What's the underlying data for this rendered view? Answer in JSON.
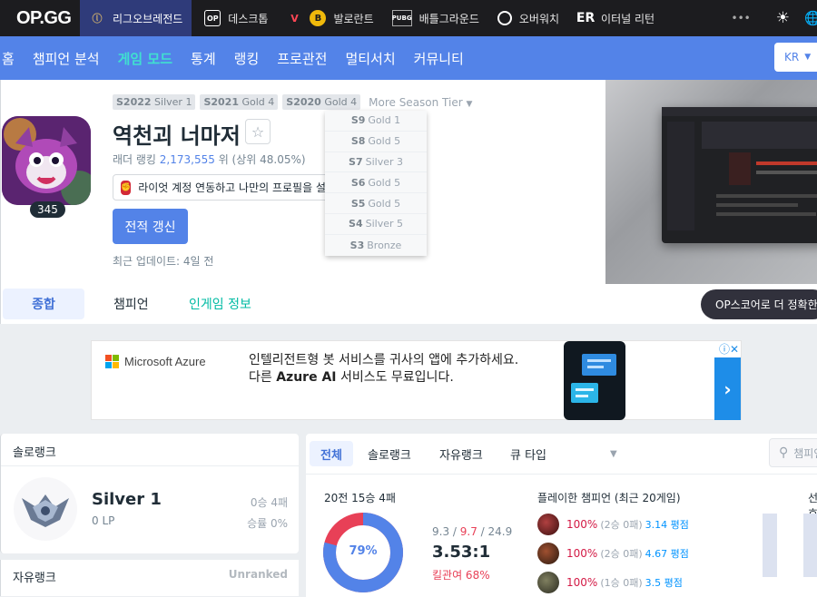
{
  "topbar": {
    "logo": "OP.GG",
    "games": [
      {
        "label": "리그오브레전드",
        "icon": "lol-icon",
        "active": true
      },
      {
        "label": "데스크톱",
        "icon": "opgg-desktop-icon",
        "active": false
      },
      {
        "label": "발로란트",
        "icon": "valorant-icon",
        "active": false
      },
      {
        "label": "배틀그라운드",
        "icon": "pubg-icon",
        "active": false
      },
      {
        "label": "오버워치",
        "icon": "overwatch-icon",
        "active": false
      },
      {
        "label": "이터널 리턴",
        "icon": "eternal-return-icon",
        "active": false
      }
    ],
    "more": "•••"
  },
  "nav": {
    "items": [
      "홈",
      "챔피언 분석",
      "게임 모드",
      "통계",
      "랭킹",
      "프로관전",
      "멀티서치",
      "커뮤니티"
    ],
    "active": "게임 모드",
    "region": "KR"
  },
  "profile": {
    "past_seasons": [
      {
        "season": "S2022",
        "tier": "Silver 1"
      },
      {
        "season": "S2021",
        "tier": "Gold 4"
      },
      {
        "season": "S2020",
        "tier": "Gold 4"
      }
    ],
    "more_season_label": "More Season Tier",
    "more_seasons": [
      {
        "season": "S9",
        "tier": "Gold 1"
      },
      {
        "season": "S8",
        "tier": "Gold 5"
      },
      {
        "season": "S7",
        "tier": "Silver 3"
      },
      {
        "season": "S6",
        "tier": "Gold 5"
      },
      {
        "season": "S5",
        "tier": "Gold 5"
      },
      {
        "season": "S4",
        "tier": "Silver 5"
      },
      {
        "season": "S3",
        "tier": "Bronze"
      }
    ],
    "level": "345",
    "name": "역천괴 너마저",
    "ladder_prefix": "래더 랭킹 ",
    "ladder_rank": "2,173,555",
    "ladder_suffix": " 위 (상위 48.05%)",
    "riot_link": "라이엇 계정 연동하고 나만의 프로필을 설정하세요",
    "refresh": "전적 갱신",
    "last_update": "최근 업데이트: 4일 전"
  },
  "tabs": {
    "overview": "종합",
    "champions": "챔피언",
    "ingame": "인게임 정보",
    "ops_button": "OP스코어로 더 정확한 평가"
  },
  "ad": {
    "brand": "Microsoft Azure",
    "line1": "인텔리전트형 봇 서비스를 귀사의 앱에 추가하세요.",
    "line2_pre": "다른 ",
    "line2_bold": "Azure AI",
    "line2_post": " 서비스도 무료입니다.",
    "arrow": "›"
  },
  "solo": {
    "title": "솔로랭크",
    "tier": "Silver 1",
    "lp": "0 LP",
    "wl": "0승 4패",
    "winrate": "승률 0%"
  },
  "flex": {
    "title": "자유랭크",
    "status": "Unranked"
  },
  "matches": {
    "tabs": [
      "전체",
      "솔로랭크",
      "자유랭크",
      "큐 타입"
    ],
    "search_placeholder": "챔피언 검색",
    "summary": "20전 15승 4패",
    "winrate_pct": 79,
    "winrate_label": "79%",
    "kills": "9.3",
    "deaths": "9.7",
    "assists": "24.9",
    "kda": "3.53:1",
    "kp": "킬관여 68%",
    "played_title": "플레이한 챔피언 (최근 20게임)",
    "champions": [
      {
        "wr": "100%",
        "rec": "(2승 0패)",
        "kda": "3.14 평점",
        "color": "#7a2a2a"
      },
      {
        "wr": "100%",
        "rec": "(2승 0패)",
        "kda": "4.67 평점",
        "color": "#5a3a2a"
      },
      {
        "wr": "100%",
        "rec": "(1승 0패)",
        "kda": "3.5 평점",
        "color": "#4a4a3a"
      }
    ],
    "position_title": "선호 포지션"
  },
  "colors": {
    "accent": "#5383e8",
    "topbar": "#1c1c1f",
    "win": "#5383e8",
    "loss": "#e84057",
    "ingame": "#00bba3"
  }
}
